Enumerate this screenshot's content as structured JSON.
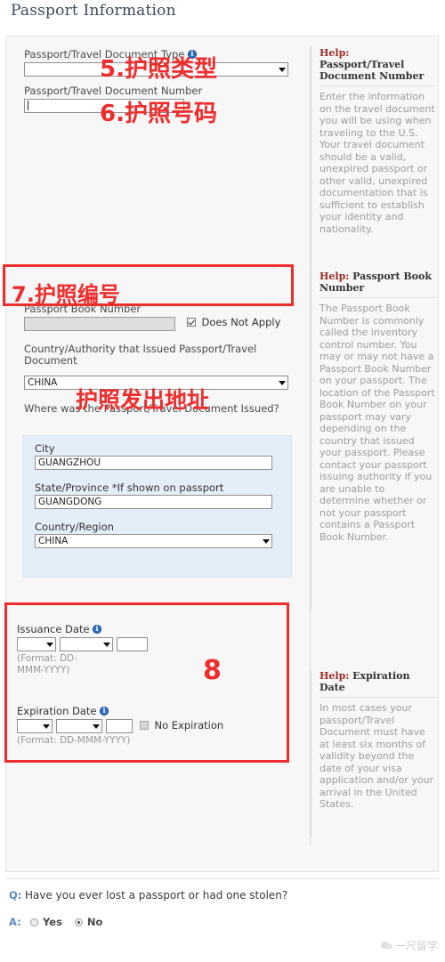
{
  "page": {
    "title": "Passport Information"
  },
  "form": {
    "doc_type": {
      "label": "Passport/Travel Document Type",
      "info_icon": "info-icon",
      "value": "",
      "caret_icon": "chevron-down-icon"
    },
    "doc_number": {
      "label": "Passport/Travel Document Number",
      "value": ""
    },
    "book_number": {
      "label": "Passport Book Number",
      "value": "",
      "does_not_apply_label": "Does Not Apply",
      "does_not_apply_checked": true
    },
    "issuing_country": {
      "label": "Country/Authority that Issued Passport/Travel Document",
      "value": "CHINA"
    },
    "issued_where": {
      "label": "Where was the Passport/Travel Document Issued?",
      "city_label": "City",
      "city_value": "GUANGZHOU",
      "state_label": "State/Province *If shown on passport",
      "state_value": "GUANGDONG",
      "country_label": "Country/Region",
      "country_value": "CHINA"
    },
    "issuance_date": {
      "label": "Issuance Date",
      "day": "",
      "month": "",
      "year": "",
      "format_hint": "(Format: DD-MMM-YYYY)"
    },
    "expiration_date": {
      "label": "Expiration Date",
      "day": "",
      "month": "",
      "year": "",
      "format_hint": "(Format: DD-MMM-YYYY)",
      "no_expiration_label": "No Expiration",
      "no_expiration_checked": false
    }
  },
  "help": {
    "block1": {
      "title_word": "Help:",
      "title_rest": " Passport/Travel Document Number",
      "body": "Enter the information on the travel document you will be using when traveling to the U.S. Your travel document should be a valid, unexpired passport or other valid, unexpired documentation that is sufficient to establish your identity and nationality."
    },
    "block2": {
      "title_word": "Help:",
      "title_rest": " Passport Book Number",
      "body": "The Passport Book Number is commonly called the inventory control number. You may or may not have a Passport Book Number on your passport. The location of the Passport Book Number on your passport may vary depending on the country that issued your passport. Please contact your passport issuing authority if you are unable to determine whether or not your passport contains a Passport Book Number."
    },
    "block3": {
      "title_word": "Help:",
      "title_rest": " Expiration Date",
      "body": "In most cases your passport/Travel Document must have at least six months of validity beyond the date of your visa application and/or your arrival in the United States."
    }
  },
  "annotations": {
    "a5": "5.护照类型",
    "a6": "6.护照号码",
    "a7": "7.护照编号",
    "a_addr": "护照发出地址",
    "a8": "8"
  },
  "question": {
    "q_prefix": "Q:",
    "q_text": "Have you ever lost a passport or had one stolen?",
    "a_prefix": "A:",
    "yes_label": "Yes",
    "no_label": "No",
    "selected": "No"
  },
  "watermark": {
    "text": "一尺留学",
    "icon": "wechat-icon"
  },
  "colors": {
    "annotation_red": "#ee2d2d",
    "help_title_red": "#9b2b24",
    "panel_bg": "#f7f7f7",
    "bluebox_bg": "#e4eef8",
    "info_blue": "#2f6fc4"
  }
}
